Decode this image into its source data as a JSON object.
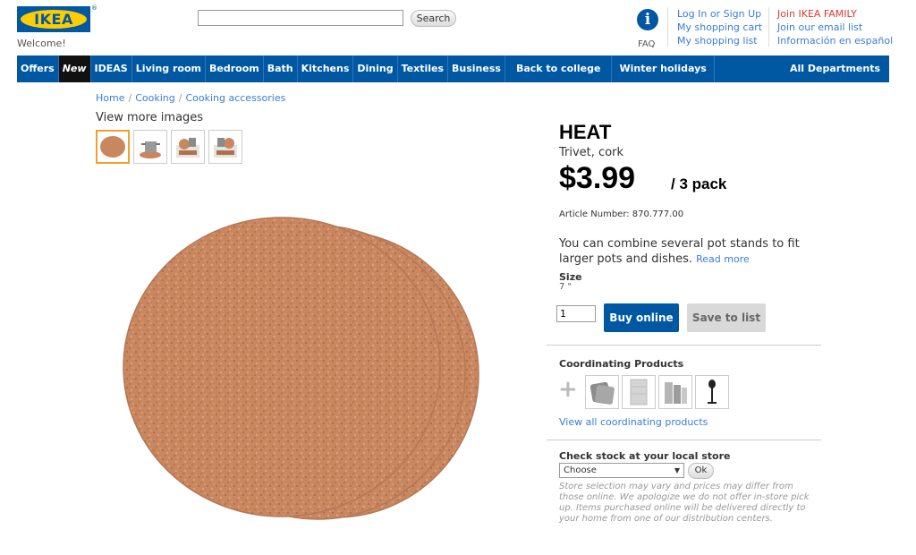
{
  "header": {
    "logo_text": "IKEA",
    "logo_reg": "®",
    "welcome": "Welcome!",
    "search_placeholder": "",
    "search_button": "Search",
    "faq_label": "FAQ",
    "links_col1": [
      "Log In or Sign Up",
      "My shopping cart",
      "My shopping list"
    ],
    "links_col2": [
      "Join IKEA FAMILY",
      "Join our email list",
      "Información en español"
    ]
  },
  "nav": {
    "items": [
      "Offers",
      "New",
      "IDEAS",
      "Living room",
      "Bedroom",
      "Bath",
      "Kitchens",
      "Dining",
      "Textiles",
      "Business",
      "Back to college",
      "Winter holidays"
    ],
    "all_departments": "All Departments"
  },
  "breadcrumb": [
    "Home",
    "Cooking",
    "Cooking accessories"
  ],
  "images": {
    "view_more": "View more images"
  },
  "product": {
    "name": "HEAT",
    "subtitle": "Trivet, cork",
    "price": "$3.99",
    "pack": "/ 3 pack",
    "article": "Article Number: 870.777.00",
    "description": "You can combine several pot stands to fit larger pots and dishes.",
    "read_more": "Read more",
    "size_label": "Size",
    "size_value": "7 \"",
    "quantity": "1",
    "buy_label": "Buy online",
    "save_label": "Save to list"
  },
  "coordinating": {
    "title": "Coordinating Products",
    "view_all": "View all coordinating products"
  },
  "stock": {
    "title": "Check stock at your local store",
    "select_value": "Choose",
    "ok_label": "Ok",
    "note": "Store selection may vary and prices may differ from those online. We apologize we do not offer in-store pick up. Items purchased online will be delivered directly to your home from one of our distribution centers."
  },
  "colors": {
    "brand_blue": "#0058a3",
    "brand_yellow": "#ffcc00",
    "link": "#3b7dd8",
    "family_red": "#e0392f",
    "cork": "#c98760"
  }
}
